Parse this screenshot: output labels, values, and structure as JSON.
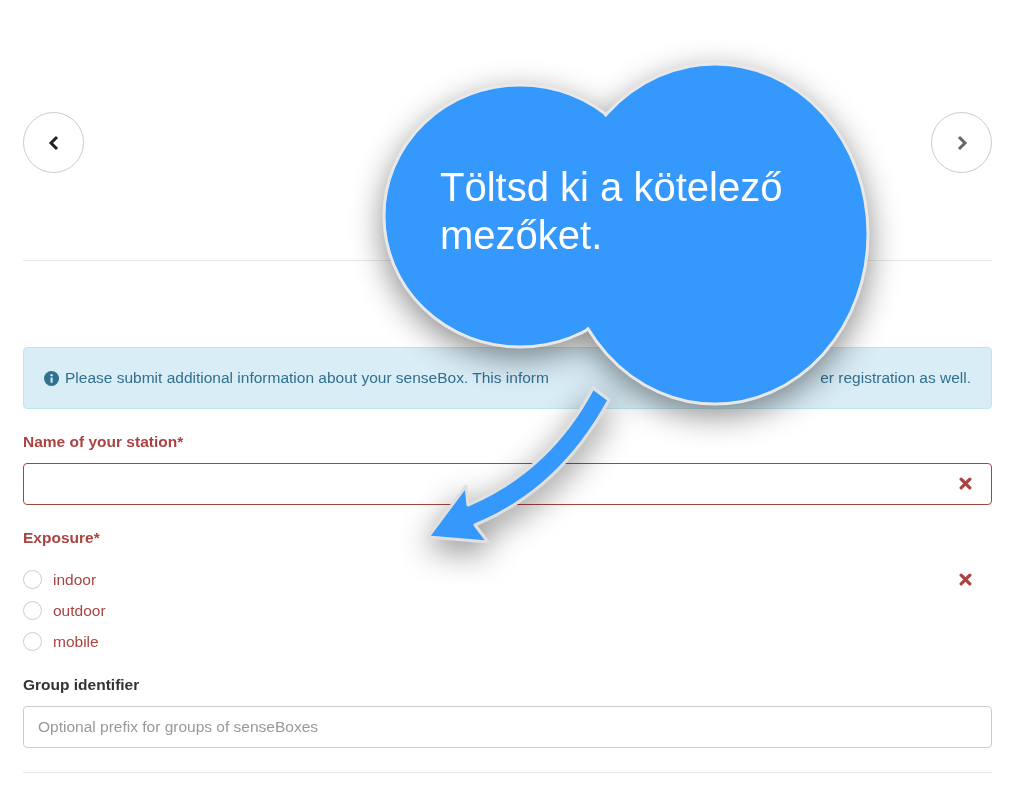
{
  "alert": {
    "text_before": "Please submit additional information about your senseBox. This inform",
    "text_after": "er registration as well."
  },
  "fields": [
    {
      "kind": "text",
      "label": "Name of your station*",
      "error": true
    },
    {
      "kind": "radio",
      "label": "Exposure*",
      "error": true,
      "options": [
        {
          "label": "indoor",
          "selected": false
        },
        {
          "label": "outdoor",
          "selected": false
        },
        {
          "label": "mobile",
          "selected": false
        }
      ]
    },
    {
      "kind": "text",
      "label": "Group identifier",
      "error": false,
      "placeholder": "Optional prefix for groups of senseBoxes"
    }
  ],
  "callout": {
    "text": "Töltsd ki a kötelező mezőket."
  }
}
